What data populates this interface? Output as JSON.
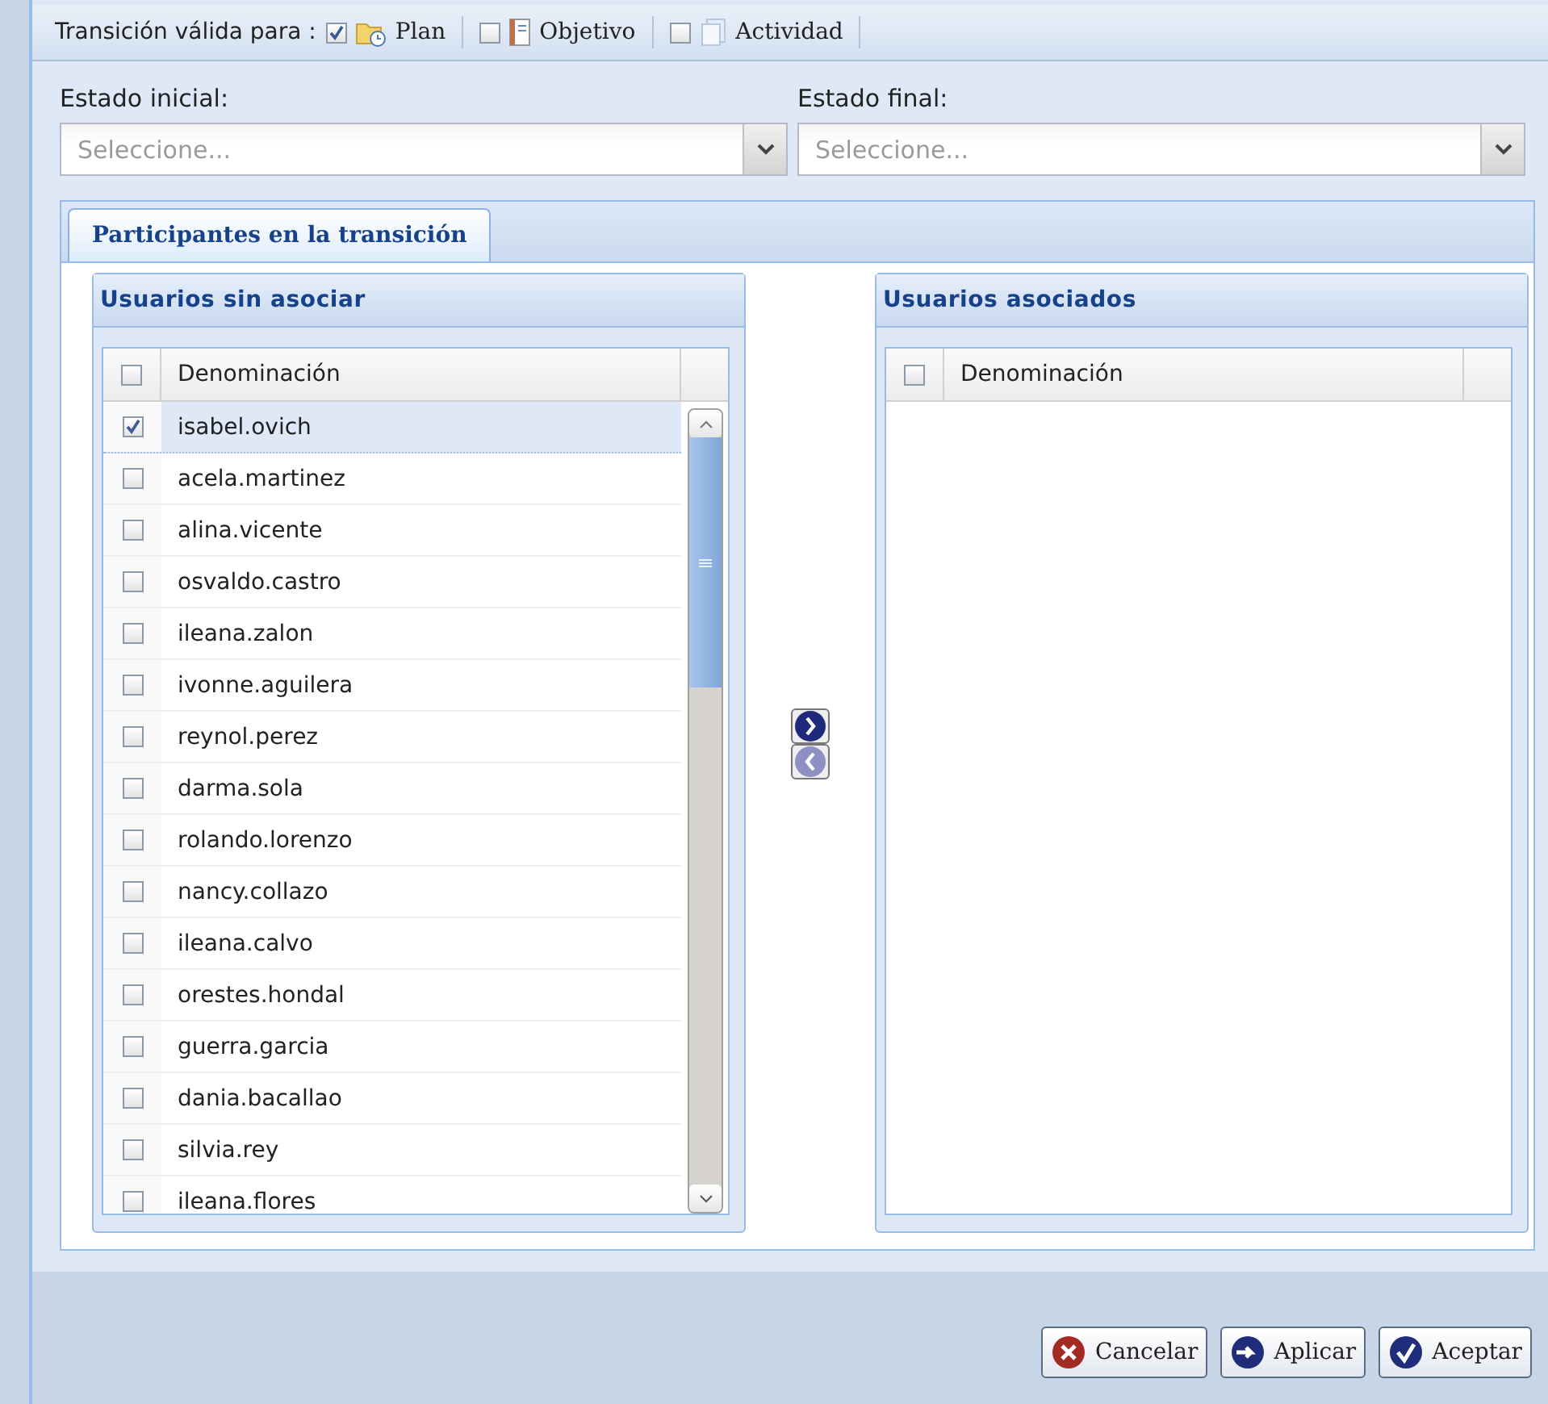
{
  "toolbar": {
    "label": "Transición válida para :",
    "options": [
      {
        "label": "Plan",
        "checked": true,
        "kind": "plan"
      },
      {
        "label": "Objetivo",
        "checked": false,
        "kind": "objective"
      },
      {
        "label": "Actividad",
        "checked": false,
        "kind": "activity"
      }
    ]
  },
  "fields": [
    {
      "label": "Estado inicial:",
      "placeholder": "Seleccione..."
    },
    {
      "label": "Estado final:",
      "placeholder": "Seleccione..."
    }
  ],
  "tabs": [
    {
      "label": "Participantes en la transición",
      "selected": true
    }
  ],
  "left_panel": {
    "title": "Usuarios sin asociar",
    "header_checked": false,
    "column": "Denominación",
    "rows": [
      {
        "name": "isabel.ovich",
        "checked": true,
        "selected": true
      },
      {
        "name": "acela.martinez",
        "checked": false,
        "selected": false
      },
      {
        "name": "alina.vicente",
        "checked": false,
        "selected": false
      },
      {
        "name": "osvaldo.castro",
        "checked": false,
        "selected": false
      },
      {
        "name": "ileana.zalon",
        "checked": false,
        "selected": false
      },
      {
        "name": "ivonne.aguilera",
        "checked": false,
        "selected": false
      },
      {
        "name": "reynol.perez",
        "checked": false,
        "selected": false
      },
      {
        "name": "darma.sola",
        "checked": false,
        "selected": false
      },
      {
        "name": "rolando.lorenzo",
        "checked": false,
        "selected": false
      },
      {
        "name": "nancy.collazo",
        "checked": false,
        "selected": false
      },
      {
        "name": "ileana.calvo",
        "checked": false,
        "selected": false
      },
      {
        "name": "orestes.hondal",
        "checked": false,
        "selected": false
      },
      {
        "name": "guerra.garcia",
        "checked": false,
        "selected": false
      },
      {
        "name": "dania.bacallao",
        "checked": false,
        "selected": false
      },
      {
        "name": "silvia.rey",
        "checked": false,
        "selected": false
      },
      {
        "name": "ileana.flores",
        "checked": false,
        "selected": false
      }
    ]
  },
  "move_buttons": [
    {
      "kind": "right",
      "disabled": false
    },
    {
      "kind": "left",
      "disabled": true
    }
  ],
  "right_panel": {
    "title": "Usuarios asociados",
    "header_checked": false,
    "column": "Denominación"
  },
  "buttons": [
    {
      "label": "Cancelar",
      "kind": "cancel"
    },
    {
      "label": "Aplicar",
      "kind": "apply"
    },
    {
      "label": "Aceptar",
      "kind": "accept"
    }
  ]
}
